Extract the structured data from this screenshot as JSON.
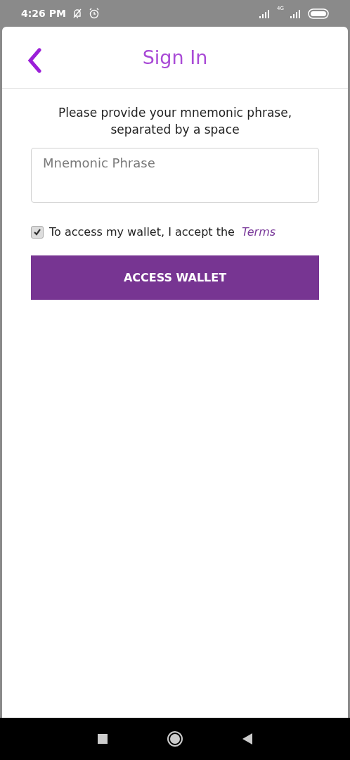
{
  "status_bar": {
    "time": "4:26 PM",
    "network": "4G"
  },
  "header": {
    "title": "Sign In"
  },
  "instructions": "Please provide your mnemonic phrase, separated by a space",
  "mnemonic_field": {
    "placeholder": "Mnemonic Phrase"
  },
  "terms": {
    "checked": true,
    "label": "To access my wallet, I accept the",
    "link": "Terms"
  },
  "access_button": {
    "label": "ACCESS WALLET"
  }
}
